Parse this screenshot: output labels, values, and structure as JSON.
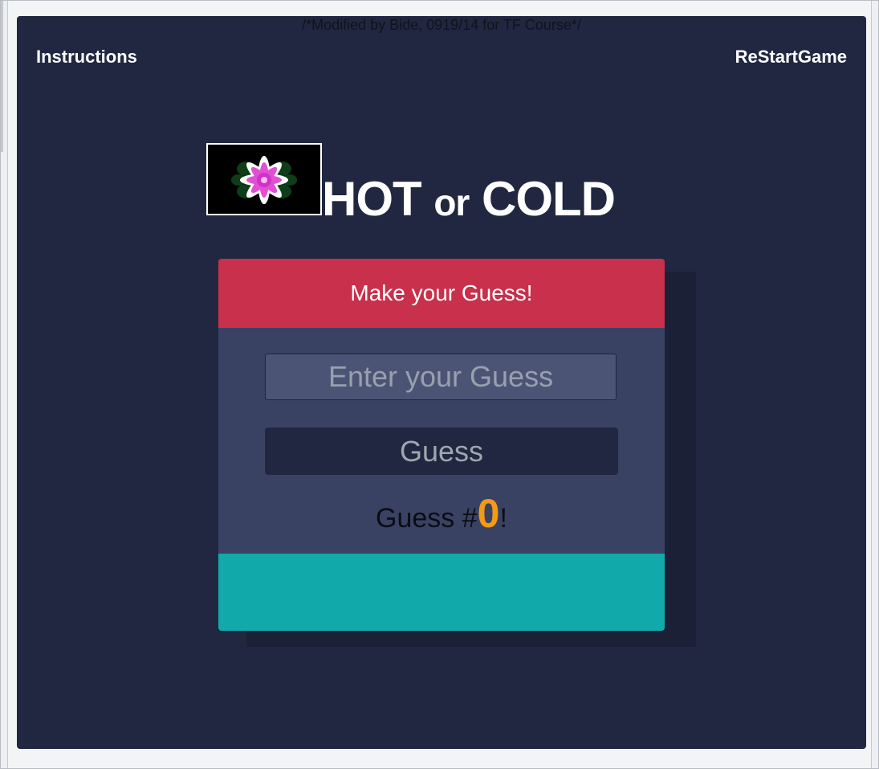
{
  "header_comment": "/*Modified by Bide, 0919/14 for TF Course*/",
  "nav": {
    "instructions_label": "Instructions",
    "restart_label": "ReStartGame"
  },
  "logo": {
    "icon": "flower-logo-icon",
    "colors": {
      "petal": "#e24fd4",
      "center": "#cf32c6",
      "tip": "#ffffff",
      "leaf": "#0f3d18"
    }
  },
  "title": {
    "hot": "HOT",
    "or": "or",
    "cold": "COLD"
  },
  "card": {
    "header_text": "Make your Guess!",
    "input_placeholder": "Enter your Guess",
    "input_value": "",
    "button_label": "Guess",
    "count_prefix": "Guess #",
    "count_value": "0",
    "count_suffix": "!"
  },
  "colors": {
    "background": "#212741",
    "header": "#c8304c",
    "panel": "#3a4263",
    "footer": "#12a9aa",
    "count_accent": "#f39a16"
  }
}
